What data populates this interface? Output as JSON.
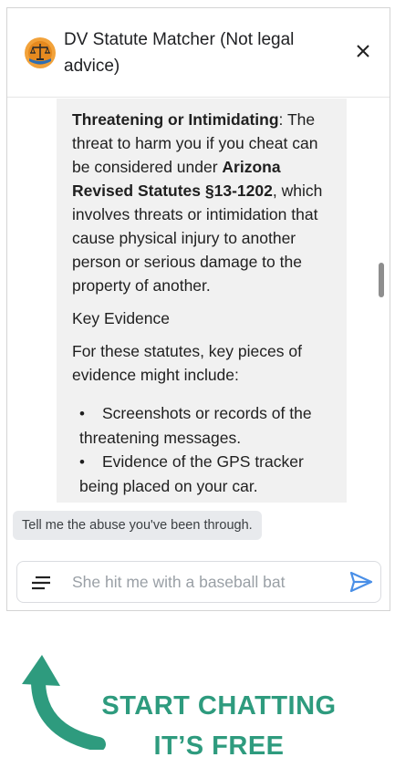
{
  "header": {
    "title": "DV Statute Matcher (Not legal advice)",
    "logo_icon": "scales-of-justice-icon",
    "close_icon": "close-icon"
  },
  "message": {
    "para1_bold": "Threatening or Intimidating",
    "para1_text1": ": The threat to harm you if you cheat can be considered under ",
    "para1_bold2": "Arizona Revised Statutes §13-1202",
    "para1_text2": ", which involves threats or intimidation that cause physical injury to another person or serious damage to the property of another.",
    "heading": "Key Evidence",
    "para2": "For these statutes, key pieces of evidence might include:",
    "bullets": [
      "Screenshots or records of the threatening messages.",
      "Evidence of the GPS tracker being placed on your car."
    ]
  },
  "suggestion_chip": "Tell me the abuse you've been through.",
  "input": {
    "placeholder": "She hit me with a baseball bat",
    "menu_icon": "menu-icon",
    "send_icon": "send-icon"
  },
  "promo": {
    "line1": "START CHATTING",
    "line2": "IT’S FREE"
  },
  "colors": {
    "bubble_bg": "#f1f1f1",
    "send_blue": "#4a8fe7",
    "promo_green": "#2e9b7e"
  }
}
